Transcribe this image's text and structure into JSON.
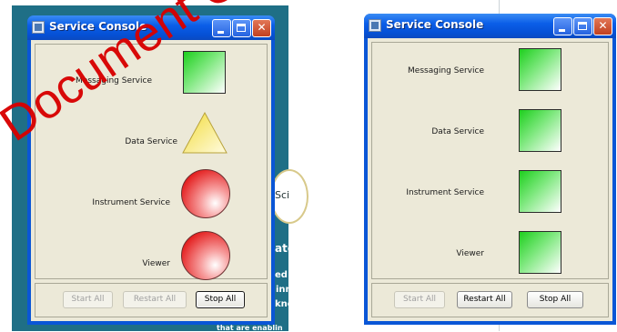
{
  "background_left_text": [
    "ate",
    "ed I",
    "inn",
    "kno",
    "that are enablin"
  ],
  "science_badge_text": "Sci",
  "watermark_text": "Document Control",
  "windows": [
    {
      "title": "Service Console",
      "services": [
        {
          "name": "Messaging Service",
          "indicator": "green-square"
        },
        {
          "name": "Data Service",
          "indicator": "yellow-triangle"
        },
        {
          "name": "Instrument Service",
          "indicator": "red-circle"
        },
        {
          "name": "Viewer",
          "indicator": "red-circle"
        }
      ],
      "buttons": {
        "start": "Start All",
        "restart": "Restart All",
        "stop": "Stop All"
      },
      "button_states": {
        "start": "disabled",
        "restart": "disabled",
        "stop": "enabled-focused"
      }
    },
    {
      "title": "Service Console",
      "services": [
        {
          "name": "Messaging Service",
          "indicator": "green-square"
        },
        {
          "name": "Data Service",
          "indicator": "green-square"
        },
        {
          "name": "Instrument Service",
          "indicator": "green-square"
        },
        {
          "name": "Viewer",
          "indicator": "green-square"
        }
      ],
      "buttons": {
        "start": "Start All",
        "restart": "Restart All",
        "stop": "Stop All"
      },
      "button_states": {
        "start": "disabled",
        "restart": "enabled",
        "stop": "enabled"
      }
    }
  ],
  "colors": {
    "titlebar": "#0b5ee8",
    "client": "#ece9d8",
    "status_ok": "#1ecf1e",
    "status_warn": "#f5e04a",
    "status_error": "#e31a1a",
    "watermark": "#d80000"
  }
}
